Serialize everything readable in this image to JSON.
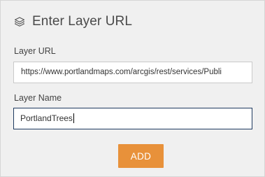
{
  "dialog": {
    "title": "Enter Layer URL",
    "icon": "layers-icon"
  },
  "fields": {
    "url_label": "Layer URL",
    "url_value": "https://www.portlandmaps.com/arcgis/rest/services/Publi",
    "name_label": "Layer Name",
    "name_value": "PortlandTrees"
  },
  "actions": {
    "add_label": "ADD"
  },
  "colors": {
    "panel_bg": "#f0f0f0",
    "accent_button": "#e8913a",
    "focused_border": "#1e3a5f"
  }
}
